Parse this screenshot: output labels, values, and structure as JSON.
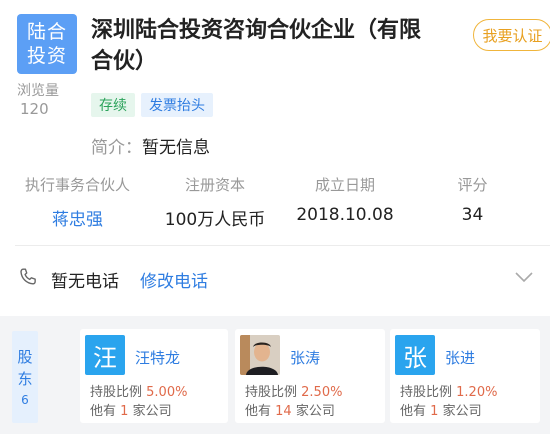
{
  "header": {
    "logo_line1": "陆合",
    "logo_line2": "投资",
    "views_label": "浏览量",
    "views_count": "120",
    "company_name": "深圳陆合投资咨询合伙企业（有限合伙）",
    "verify_label": "我要认证",
    "tags": [
      "存续",
      "发票抬头"
    ],
    "intro_label": "简介：",
    "intro_value": "暂无信息"
  },
  "info": [
    {
      "label": "执行事务合伙人",
      "value": "蒋忠强"
    },
    {
      "label": "注册资本",
      "value": "100万人民币"
    },
    {
      "label": "成立日期",
      "value": "2018.10.08"
    },
    {
      "label": "评分",
      "value": "34"
    }
  ],
  "phone": {
    "icon": "phone-icon",
    "status": "暂无电话",
    "edit_label": "修改电话"
  },
  "shareholders": {
    "label_line1": "股",
    "label_line2": "东",
    "count": "6",
    "ratio_label": "持股比例",
    "other_prefix": "他有",
    "other_suffix": "家公司",
    "items": [
      {
        "avatar_char": "汪",
        "name": "汪特龙",
        "ratio": "5.00%",
        "companies": "1"
      },
      {
        "avatar_char": "",
        "name": "张涛",
        "ratio": "2.50%",
        "companies": "14"
      },
      {
        "avatar_char": "张",
        "name": "张进",
        "ratio": "1.20%",
        "companies": "1"
      }
    ]
  },
  "colors": {
    "accent": "#2f7de1",
    "logo": "#5c9ff5",
    "status_green": "#2ca35b",
    "verify_orange": "#e8a020",
    "highlight_red": "#e06a4a",
    "avatar_blue": "#2aa4ee"
  }
}
